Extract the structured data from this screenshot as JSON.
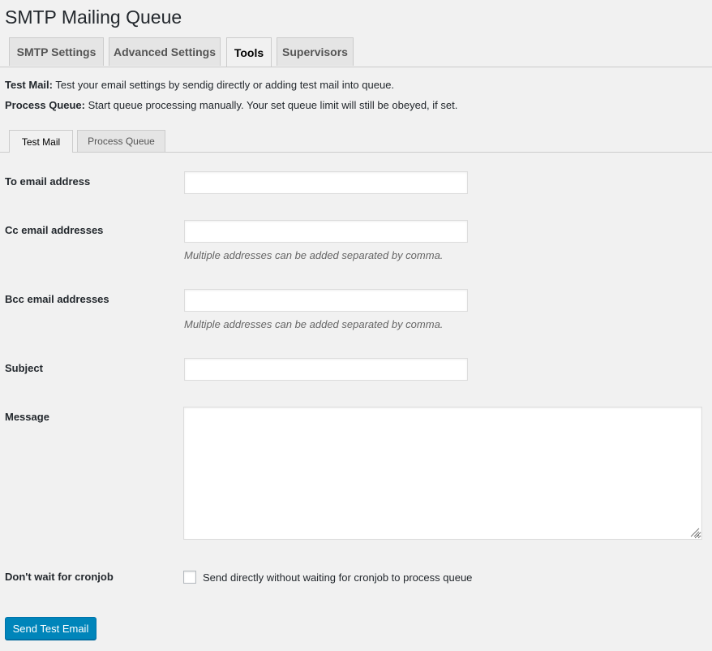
{
  "page": {
    "title": "SMTP Mailing Queue"
  },
  "nav_tabs": [
    {
      "label": "SMTP Settings",
      "active": false
    },
    {
      "label": "Advanced Settings",
      "active": false
    },
    {
      "label": "Tools",
      "active": true
    },
    {
      "label": "Supervisors",
      "active": false
    }
  ],
  "intro": {
    "test_mail_title": "Test Mail:",
    "test_mail_text": " Test your email settings by sendig directly or adding test mail into queue.",
    "process_queue_title": "Process Queue:",
    "process_queue_text": " Start queue processing manually. Your set queue limit will still be obeyed, if set."
  },
  "sub_tabs": [
    {
      "label": "Test Mail",
      "active": true
    },
    {
      "label": "Process Queue",
      "active": false
    }
  ],
  "form": {
    "to": {
      "label": "To email address",
      "value": ""
    },
    "cc": {
      "label": "Cc email addresses",
      "value": "",
      "description": "Multiple addresses can be added separated by comma."
    },
    "bcc": {
      "label": "Bcc email addresses",
      "value": "",
      "description": "Multiple addresses can be added separated by comma."
    },
    "subject": {
      "label": "Subject",
      "value": ""
    },
    "message": {
      "label": "Message",
      "value": ""
    },
    "dont_wait": {
      "label": "Don't wait for cronjob",
      "checkbox_label": "Send directly without waiting for cronjob to process queue",
      "checked": false
    },
    "submit_label": "Send Test Email"
  },
  "colors": {
    "primary": "#0085ba",
    "background": "#f1f1f1",
    "tab_inactive": "#e5e5e5"
  },
  "icons": {
    "resize": "resize-grip-icon"
  }
}
